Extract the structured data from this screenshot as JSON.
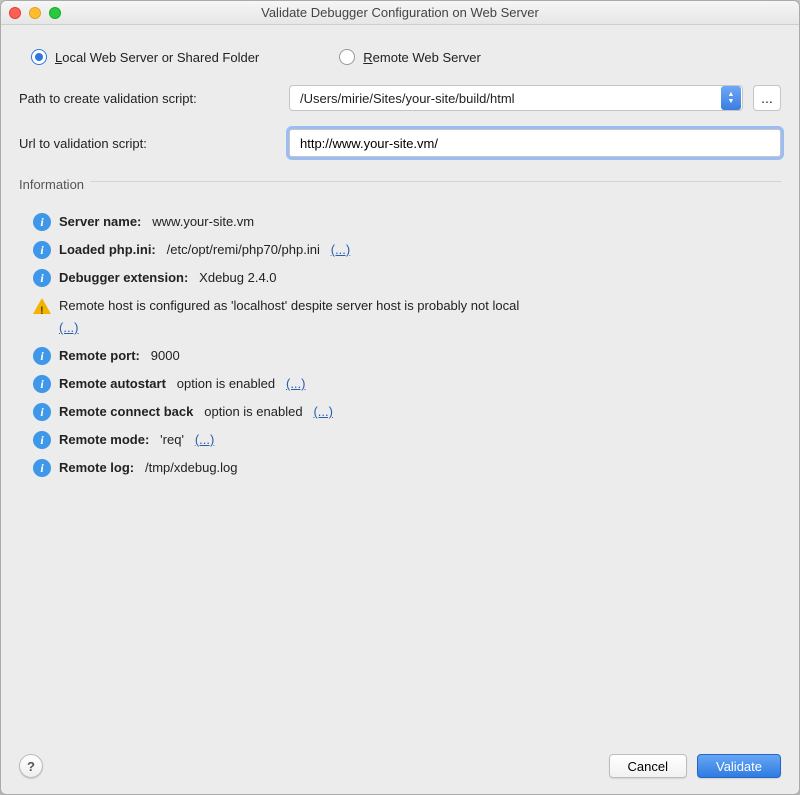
{
  "window": {
    "title": "Validate Debugger Configuration on Web Server"
  },
  "radios": {
    "local_prefix": "L",
    "local_rest": "ocal Web Server or Shared Folder",
    "remote_prefix": "R",
    "remote_rest": "emote Web Server"
  },
  "form": {
    "path_label": "Path to create validation script:",
    "path_value": "/Users/mirie/Sites/your-site/build/html",
    "url_label": "Url to validation script:",
    "url_value": "http://www.your-site.vm/"
  },
  "section": {
    "title": "Information"
  },
  "info": {
    "server_name_label": "Server name:",
    "server_name_value": "www.your-site.vm",
    "php_ini_label": "Loaded php.ini:",
    "php_ini_value": "/etc/opt/remi/php70/php.ini",
    "debugger_ext_label": "Debugger extension:",
    "debugger_ext_value": "Xdebug 2.4.0",
    "warn_text": "Remote host is configured as 'localhost' despite server host is probably not local",
    "remote_port_label": "Remote port:",
    "remote_port_value": "9000",
    "remote_autostart_label": "Remote autostart",
    "remote_autostart_suffix": "option is enabled",
    "remote_connect_back_label": "Remote connect back",
    "remote_connect_back_suffix": "option is enabled",
    "remote_mode_label": "Remote mode:",
    "remote_mode_value": "'req'",
    "remote_log_label": "Remote log:",
    "remote_log_value": "/tmp/xdebug.log",
    "link_text": "(...)"
  },
  "buttons": {
    "help": "?",
    "cancel": "Cancel",
    "validate": "Validate",
    "ellipsis": "..."
  }
}
